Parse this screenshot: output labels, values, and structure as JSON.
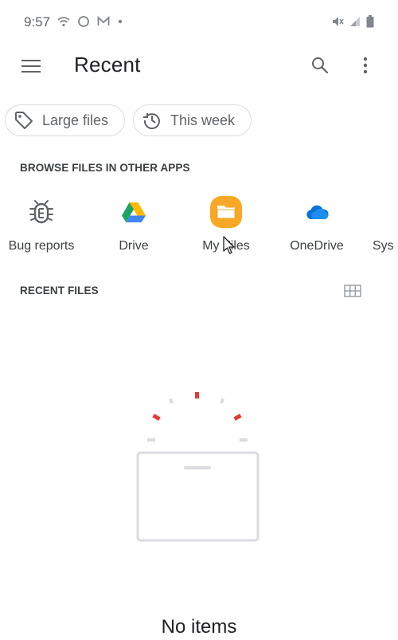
{
  "status_bar": {
    "time": "9:57",
    "left_icons": [
      "wifi-icon",
      "circle-icon",
      "mail-icon",
      "dot-icon"
    ],
    "right_icons": [
      "mute-icon",
      "signal-icon",
      "battery-icon"
    ]
  },
  "app_bar": {
    "title": "Recent",
    "icons": [
      "menu-icon",
      "search-icon",
      "more-vert-icon"
    ]
  },
  "chips": [
    {
      "label": "Large files",
      "icon": "tag-icon"
    },
    {
      "label": "This week",
      "icon": "history-icon"
    }
  ],
  "browse": {
    "header": "BROWSE FILES IN OTHER APPS",
    "apps": [
      {
        "label": "Bug reports",
        "icon": "bug-icon"
      },
      {
        "label": "Drive",
        "icon": "drive-icon"
      },
      {
        "label": "My Files",
        "icon": "folder-icon"
      },
      {
        "label": "OneDrive",
        "icon": "cloud-icon"
      },
      {
        "label": "Sys",
        "icon": ""
      }
    ]
  },
  "recent": {
    "header": "RECENT FILES",
    "view_icon": "grid-view-icon"
  },
  "empty_state": {
    "text": "No items"
  },
  "colors": {
    "text_primary": "#202124",
    "text_secondary": "#5f6368",
    "drive_green": "#1ea362",
    "drive_yellow": "#ffba00",
    "drive_blue": "#4285f4",
    "myfiles_orange": "#f9a825",
    "onedrive_blue": "#0a6fd8",
    "accent_red": "#e53935"
  }
}
